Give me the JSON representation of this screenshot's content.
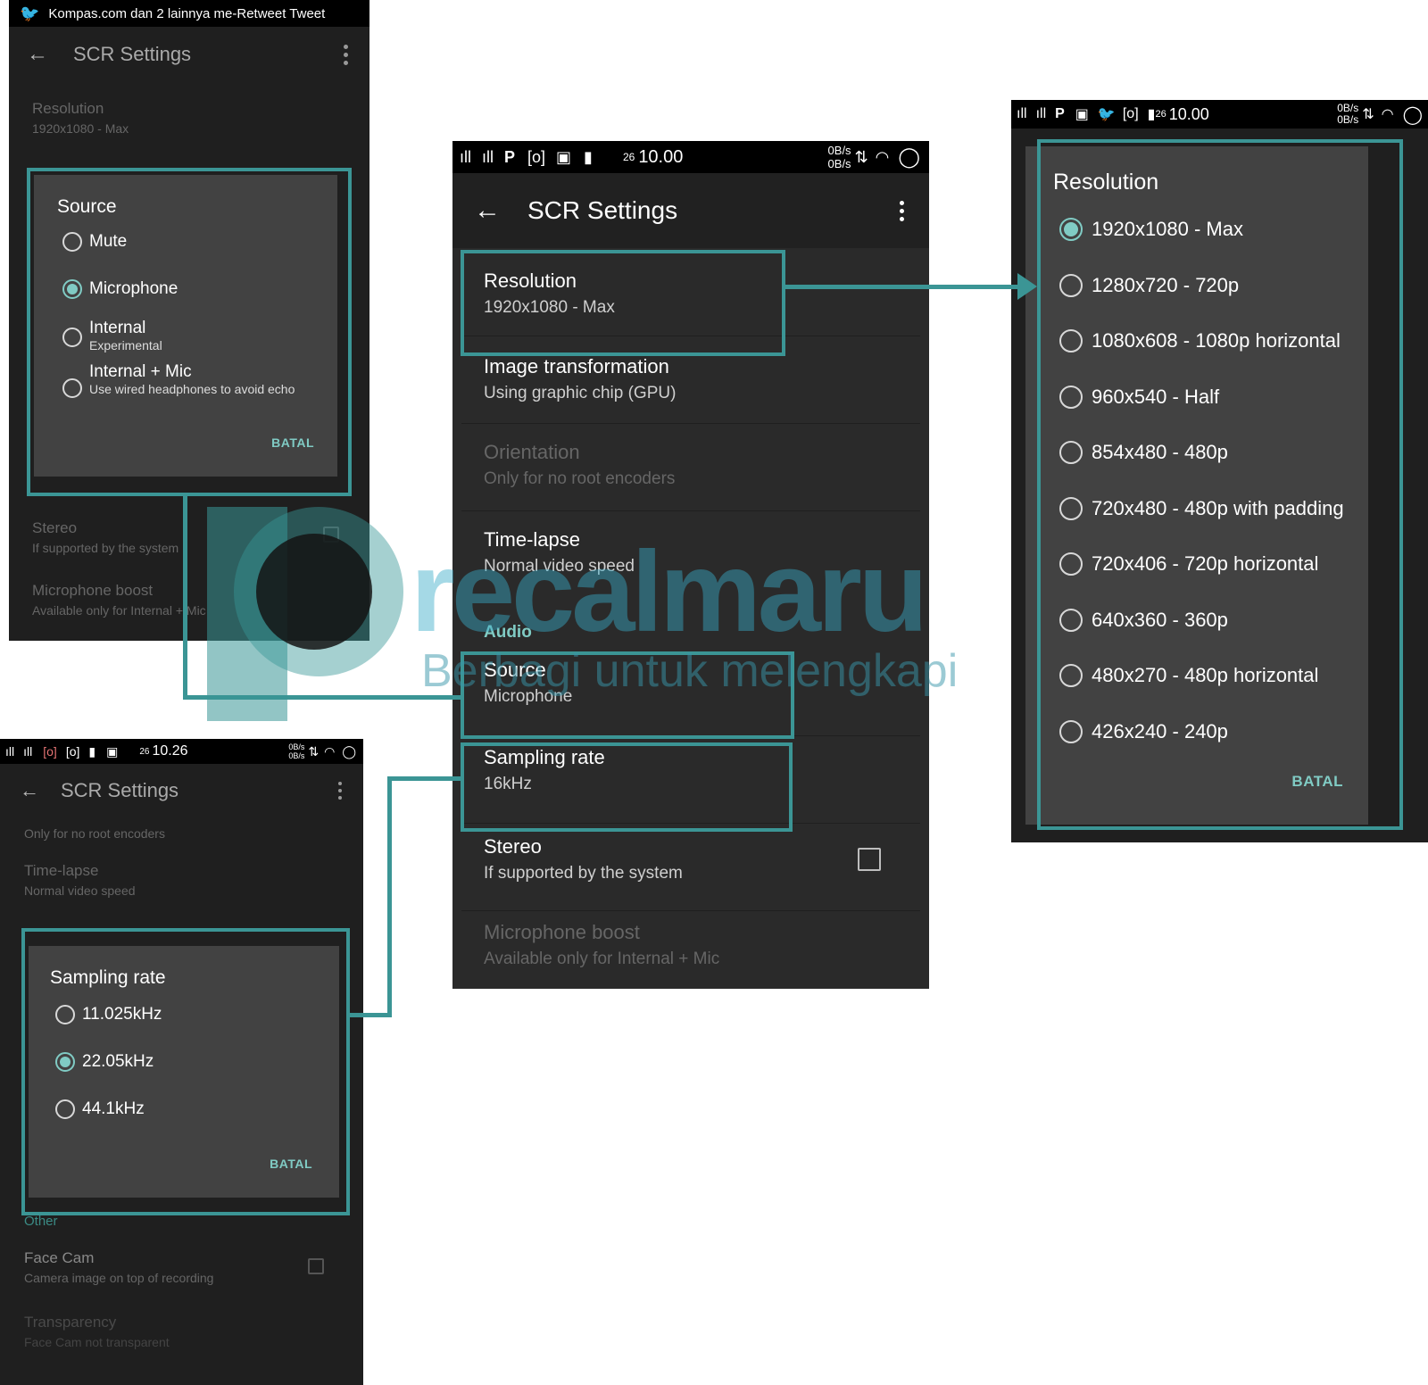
{
  "tweet_bar": {
    "text": "Kompas.com dan 2 lainnya me-Retweet Tweet"
  },
  "app_title": "SCR Settings",
  "status": {
    "time_main": "10.00",
    "time_bottom": "10.26",
    "date_small": "26",
    "rate_up": "0B/s",
    "rate_down": "0B/s"
  },
  "settings": {
    "resolution": {
      "title": "Resolution",
      "value": "1920x1080 - Max"
    },
    "image_transformation": {
      "title": "Image transformation",
      "value": "Using graphic chip (GPU)"
    },
    "orientation": {
      "title": "Orientation",
      "value": "Only for no root encoders"
    },
    "timelapse": {
      "title": "Time-lapse",
      "value": "Normal video speed"
    },
    "audio_header": "Audio",
    "source": {
      "title": "Source",
      "value": "Microphone"
    },
    "sampling_rate": {
      "title": "Sampling rate",
      "value": "16kHz"
    },
    "stereo": {
      "title": "Stereo",
      "value": "If supported by the system"
    },
    "mic_boost": {
      "title": "Microphone boost",
      "value": "Available only for Internal + Mic"
    },
    "other_header": "Other",
    "face_cam": {
      "title": "Face Cam",
      "value": "Camera image on top of recording"
    },
    "transparency": {
      "title": "Transparency",
      "value": "Face Cam not transparent"
    }
  },
  "source_dialog": {
    "title": "Source",
    "options": [
      {
        "label": "Mute",
        "sub": "",
        "selected": false
      },
      {
        "label": "Microphone",
        "sub": "",
        "selected": true
      },
      {
        "label": "Internal",
        "sub": "Experimental",
        "selected": false
      },
      {
        "label": "Internal + Mic",
        "sub": "Use wired headphones to avoid echo",
        "selected": false
      }
    ],
    "cancel": "BATAL"
  },
  "sampling_dialog": {
    "title": "Sampling rate",
    "options": [
      {
        "label": "11.025kHz",
        "selected": false
      },
      {
        "label": "22.05kHz",
        "selected": true
      },
      {
        "label": "44.1kHz",
        "selected": false
      }
    ],
    "cancel": "BATAL"
  },
  "resolution_dialog": {
    "title": "Resolution",
    "options": [
      {
        "label": "1920x1080 - Max",
        "selected": true
      },
      {
        "label": "1280x720 - 720p",
        "selected": false
      },
      {
        "label": "1080x608 - 1080p horizontal",
        "selected": false
      },
      {
        "label": "960x540 - Half",
        "selected": false
      },
      {
        "label": "854x480 - 480p",
        "selected": false
      },
      {
        "label": "720x480 - 480p with padding",
        "selected": false
      },
      {
        "label": "720x406 - 720p horizontal",
        "selected": false
      },
      {
        "label": "640x360 - 360p",
        "selected": false
      },
      {
        "label": "480x270 - 480p horizontal",
        "selected": false
      },
      {
        "label": "426x240 - 240p",
        "selected": false
      }
    ],
    "cancel": "BATAL"
  },
  "watermark": {
    "brand": "recalmaru",
    "tagline": "Berbagi untuk melengkapi"
  },
  "colors": {
    "accent": "#3b9595",
    "radio_accent": "#80cbc4",
    "background": "#262626"
  }
}
